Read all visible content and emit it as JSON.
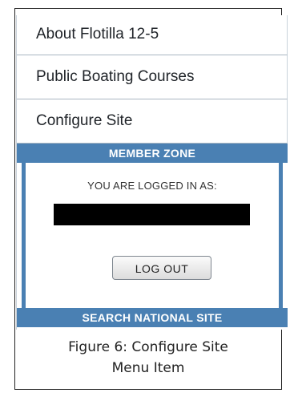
{
  "menu": {
    "items": [
      {
        "label": "About Flotilla 12-5"
      },
      {
        "label": "Public Boating Courses"
      },
      {
        "label": "Configure Site"
      }
    ]
  },
  "member_zone": {
    "header": "MEMBER ZONE",
    "logged_in_label": "YOU ARE LOGGED IN AS:",
    "logout_button": "LOG OUT"
  },
  "search": {
    "label": "SEARCH NATIONAL SITE"
  },
  "caption": {
    "line1": "Figure 6: Configure Site",
    "line2": "Menu Item"
  },
  "colors": {
    "accent_blue": "#4a80b3",
    "redaction": "#000000",
    "text": "#1f2328"
  }
}
